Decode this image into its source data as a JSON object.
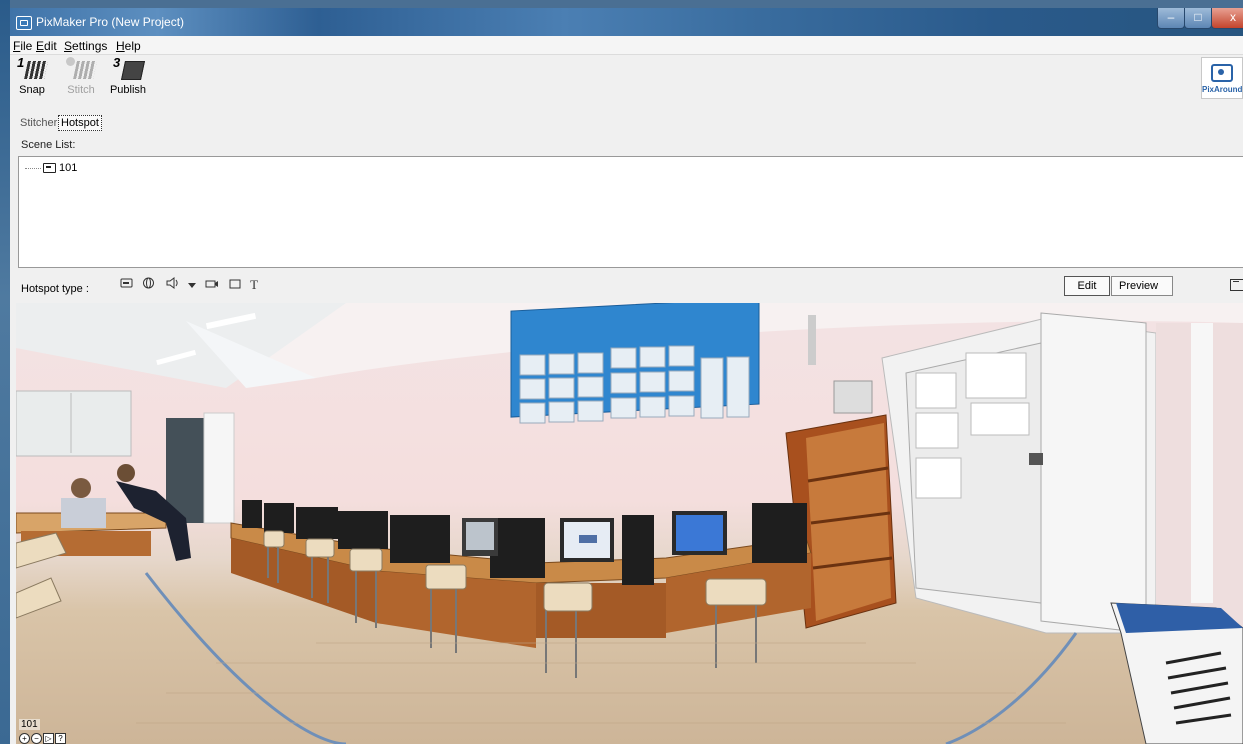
{
  "window": {
    "title": "PixMaker Pro (New Project)",
    "min": "–",
    "max": "□",
    "close": "x"
  },
  "menu": [
    {
      "key": "F",
      "rest": "ile"
    },
    {
      "key": "E",
      "rest": "dit"
    },
    {
      "key": "S",
      "rest": "ettings"
    },
    {
      "key": "H",
      "rest": "elp"
    }
  ],
  "toolbar": {
    "snap": {
      "num": "1",
      "label": "Snap"
    },
    "stitch": {
      "label": "Stitch",
      "enabled": false
    },
    "publish": {
      "num": "3",
      "label": "Publish"
    },
    "brand": "PixAround"
  },
  "tabs": {
    "stitcher": "Stitcher",
    "hotspot": "Hotspot",
    "active": "hotspot"
  },
  "scenes": {
    "label": "Scene List:",
    "items": [
      "101"
    ]
  },
  "hotspot": {
    "label": "Hotspot type :",
    "types": [
      "scene-icon",
      "globe-icon",
      "sound-icon",
      "dropdown-arrow-icon",
      "video-icon",
      "image-icon",
      "text-icon"
    ],
    "text_glyph": "T",
    "edit": "Edit",
    "preview": "Preview"
  },
  "viewer": {
    "scene": "101",
    "help": "?"
  },
  "colors": {
    "titlebar": "#3f73a8",
    "panorama_wall": "#f3e3e4",
    "floor": "#cdb598"
  }
}
